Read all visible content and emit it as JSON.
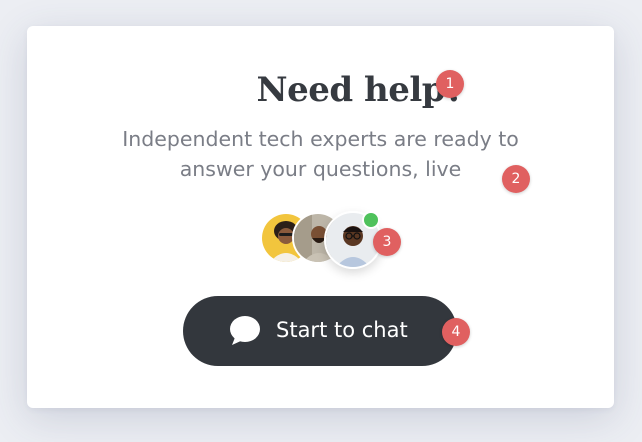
{
  "help_card": {
    "title": "Need help?",
    "subtitle": "Independent tech experts are ready to answer your questions, live",
    "avatars": [
      {
        "icon": "avatar-woman-yellow-background"
      },
      {
        "icon": "avatar-man-outdoor-background"
      },
      {
        "icon": "avatar-man-glasses",
        "online": true
      }
    ],
    "chat_button": {
      "label": "Start to chat",
      "icon": "chat-bubble-icon"
    }
  },
  "annotations": [
    "1",
    "2",
    "3",
    "4"
  ],
  "colors": {
    "button_bg": "#33373d",
    "badge_red": "#e06060",
    "online_green": "#4fc25c",
    "title_text": "#363a40",
    "subtitle_text": "#7a7d86"
  }
}
